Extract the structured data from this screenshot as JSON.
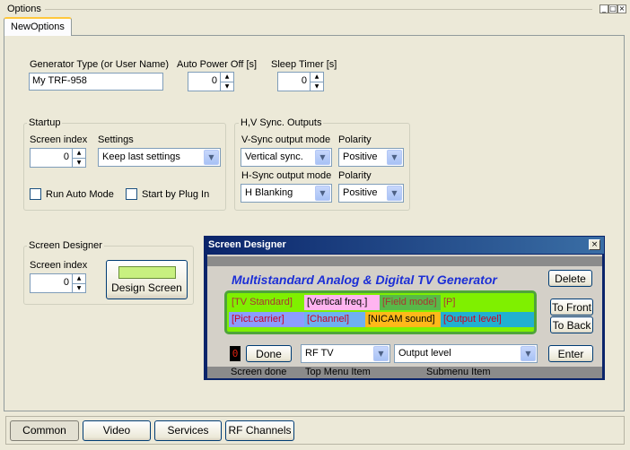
{
  "window": {
    "title": "Options",
    "controls": [
      "_",
      "□",
      "×"
    ]
  },
  "tab": {
    "active_label": "NewOptions"
  },
  "generator": {
    "type_label": "Generator Type (or User Name)",
    "type_value": "My TRF-958",
    "auto_power_label": "Auto Power Off [s]",
    "auto_power_value": "0",
    "sleep_label": "Sleep Timer [s]",
    "sleep_value": "0"
  },
  "startup": {
    "title": "Startup",
    "screen_index_label": "Screen index",
    "screen_index_value": "0",
    "settings_label": "Settings",
    "settings_value": "Keep last settings",
    "run_auto_label": "Run Auto Mode",
    "start_plugin_label": "Start by Plug In"
  },
  "sync": {
    "title": "H,V Sync. Outputs",
    "vsync_label": "V-Sync output mode",
    "vsync_value": "Vertical sync.",
    "vpolarity_label": "Polarity",
    "vpolarity_value": "Positive",
    "hsync_label": "H-Sync output mode",
    "hsync_value": "H Blanking",
    "hpolarity_label": "Polarity",
    "hpolarity_value": "Positive"
  },
  "designer_group": {
    "title": "Screen Designer",
    "screen_index_label": "Screen index",
    "screen_index_value": "0",
    "design_button": "Design Screen"
  },
  "popup": {
    "title": "Screen Designer",
    "heading": "Multistandard Analog & Digital TV Generator",
    "row1": [
      "[TV Standard]",
      "[Vertical freq.]",
      "[Field mode]",
      "[P]"
    ],
    "row2": [
      "[Pict.carrier]",
      "[Channel]",
      "[NICAM sound]",
      "[Output level]"
    ],
    "delete_button": "Delete",
    "to_front_button": "To Front",
    "to_back_button": "To Back",
    "enter_button": "Enter",
    "done_button": "Done",
    "led_value": "0",
    "top_menu_value": "RF TV",
    "submenu_value": "Output level",
    "caption_screen_done": "Screen done",
    "caption_top_menu": "Top Menu Item",
    "caption_submenu": "Submenu Item"
  },
  "bottom_tabs": [
    "Common",
    "Video",
    "Services",
    "RF Channels"
  ]
}
